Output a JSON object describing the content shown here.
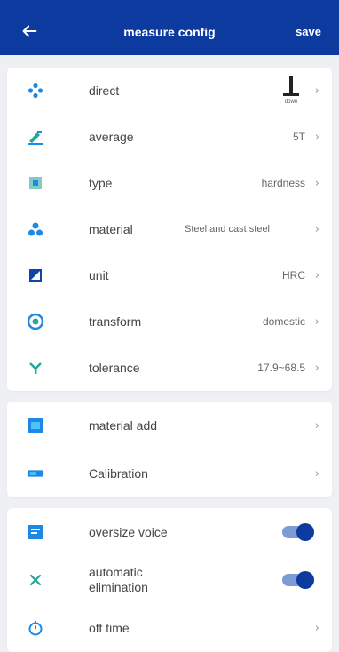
{
  "header": {
    "title": "measure config",
    "save_label": "save",
    "bg": "#0d3a9e"
  },
  "rows1": [
    {
      "icon": "direction-icon",
      "label": "direct",
      "value": "",
      "value_sub": "down"
    },
    {
      "icon": "average-icon",
      "label": "average",
      "value": "5T"
    },
    {
      "icon": "type-icon",
      "label": "type",
      "value": "hardness"
    },
    {
      "icon": "material-icon",
      "label": "material",
      "value": "Steel and cast steel"
    },
    {
      "icon": "unit-icon",
      "label": "unit",
      "value": "HRC"
    },
    {
      "icon": "transform-icon",
      "label": "transform",
      "value": "domestic"
    },
    {
      "icon": "tolerance-icon",
      "label": "tolerance",
      "value": "17.9~68.5"
    }
  ],
  "rows2": [
    {
      "icon": "material-add-icon",
      "label": "material add"
    },
    {
      "icon": "calibration-icon",
      "label": "Calibration"
    }
  ],
  "rows3": [
    {
      "icon": "voice-icon",
      "label": "oversize voice",
      "toggle": true
    },
    {
      "icon": "close-icon",
      "label": "automatic elimination",
      "toggle": true
    },
    {
      "icon": "timer-icon",
      "label": "off time"
    }
  ],
  "chevron": "›",
  "accent": "#1e88e5",
  "secondary": "#26a69a"
}
